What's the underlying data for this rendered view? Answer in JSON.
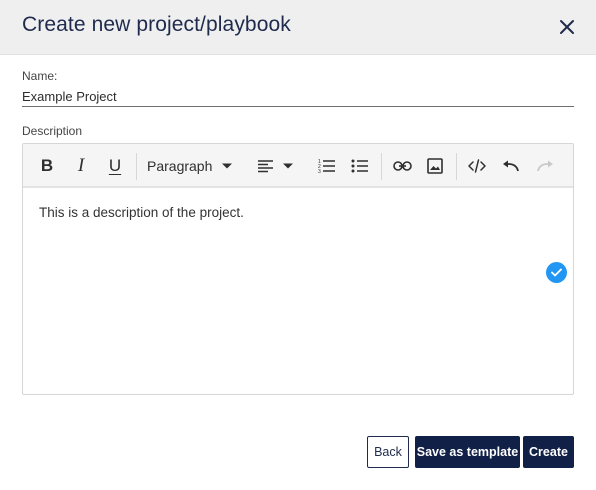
{
  "dialog": {
    "title": "Create new project/playbook",
    "close_icon": "close-icon"
  },
  "form": {
    "name_label": "Name:",
    "name_value": "Example Project",
    "description_label": "Description"
  },
  "editor": {
    "toolbar": {
      "bold": "B",
      "italic": "I",
      "underline": "U",
      "block_format": "Paragraph",
      "icons": [
        "bold-icon",
        "italic-icon",
        "underline-icon",
        "chevron-down-icon",
        "align-left-icon",
        "numbered-list-icon",
        "bullet-list-icon",
        "link-icon",
        "image-icon",
        "code-icon",
        "undo-icon",
        "redo-icon"
      ]
    },
    "content": "This is a description of the project.",
    "status_icon": "check-circle-icon"
  },
  "buttons": {
    "back": "Back",
    "save_template": "Save as template",
    "create": "Create"
  },
  "colors": {
    "primary": "#102046",
    "title": "#1f2a4d",
    "accent": "#2196f3",
    "header_bg": "#efefef"
  }
}
